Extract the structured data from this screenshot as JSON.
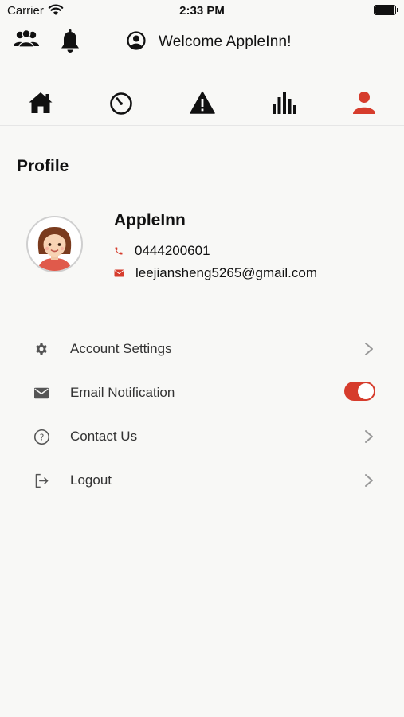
{
  "status_bar": {
    "carrier": "Carrier",
    "time": "2:33 PM"
  },
  "header": {
    "welcome": "Welcome AppleInn!",
    "icons": [
      "group-icon",
      "bell-icon",
      "user-circle-icon"
    ]
  },
  "tabs": [
    {
      "name": "home",
      "icon": "home-icon",
      "active": false
    },
    {
      "name": "timer",
      "icon": "timer-icon",
      "active": false
    },
    {
      "name": "alert",
      "icon": "warning-icon",
      "active": false
    },
    {
      "name": "stats",
      "icon": "bar-chart-icon",
      "active": false
    },
    {
      "name": "profile",
      "icon": "person-icon",
      "active": true
    }
  ],
  "page": {
    "title": "Profile"
  },
  "profile": {
    "name": "AppleInn",
    "phone": "0444200601",
    "email": "leejiansheng5265@gmail.com"
  },
  "menu": [
    {
      "label": "Account Settings",
      "icon": "gear-icon",
      "control": "chevron"
    },
    {
      "label": "Email Notification",
      "icon": "envelope-icon",
      "control": "toggle",
      "toggle_on": true
    },
    {
      "label": "Contact Us",
      "icon": "question-circle-icon",
      "control": "chevron"
    },
    {
      "label": "Logout",
      "icon": "logout-icon",
      "control": "chevron"
    }
  ],
  "colors": {
    "accent": "#d63c2c",
    "background": "#f8f8f6",
    "text": "#111111",
    "icon_gray": "#555555"
  }
}
